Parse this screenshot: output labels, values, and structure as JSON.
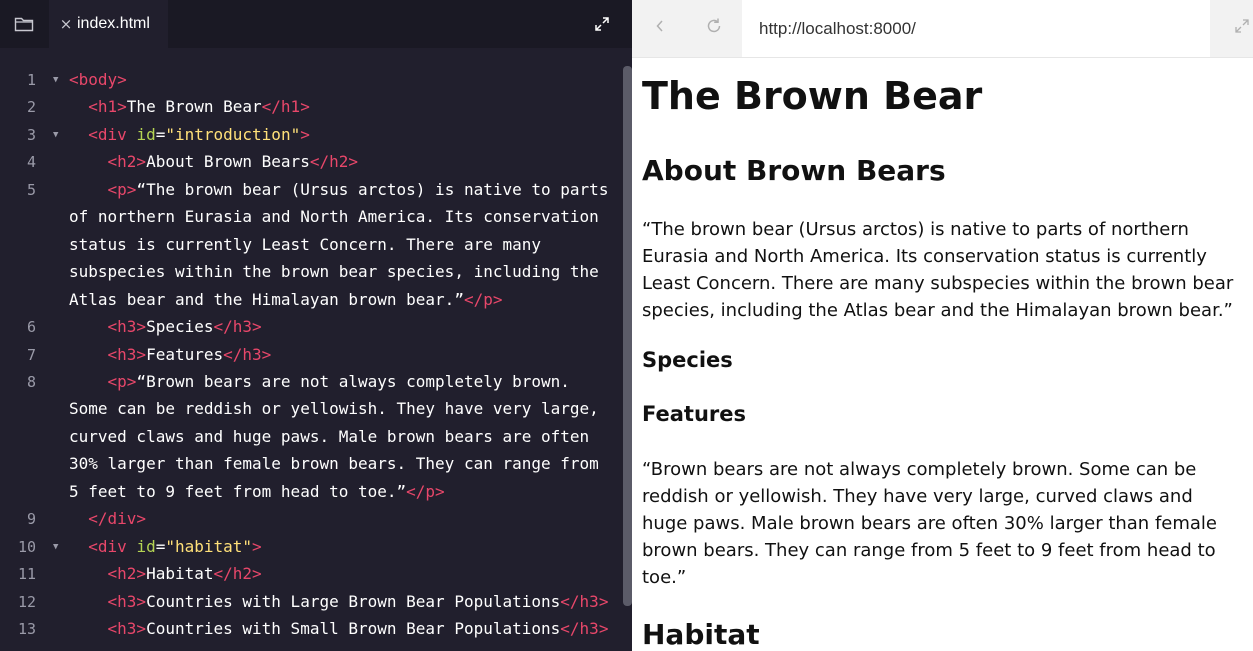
{
  "editor": {
    "tab_close": "×",
    "tab_label": "index.html",
    "icons": {
      "folder": "folder-icon",
      "expand": "expand-icon"
    },
    "lines": [
      {
        "num": "1",
        "fold": true,
        "parts": [
          {
            "t": "tag",
            "v": "<body>"
          }
        ]
      },
      {
        "num": "2",
        "fold": false,
        "parts": [
          {
            "t": "txt",
            "v": "  "
          },
          {
            "t": "tag",
            "v": "<h1>"
          },
          {
            "t": "txt",
            "v": "The Brown Bear"
          },
          {
            "t": "tag",
            "v": "</h1>"
          }
        ]
      },
      {
        "num": "3",
        "fold": true,
        "parts": [
          {
            "t": "txt",
            "v": "  "
          },
          {
            "t": "tag",
            "v": "<div "
          },
          {
            "t": "attr",
            "v": "id"
          },
          {
            "t": "txt",
            "v": "="
          },
          {
            "t": "str",
            "v": "\"introduction\""
          },
          {
            "t": "tag",
            "v": ">"
          }
        ]
      },
      {
        "num": "4",
        "fold": false,
        "parts": [
          {
            "t": "txt",
            "v": "    "
          },
          {
            "t": "tag",
            "v": "<h2>"
          },
          {
            "t": "txt",
            "v": "About Brown Bears"
          },
          {
            "t": "tag",
            "v": "</h2>"
          }
        ]
      },
      {
        "num": "5",
        "fold": false,
        "parts": [
          {
            "t": "txt",
            "v": "    "
          },
          {
            "t": "tag",
            "v": "<p>"
          },
          {
            "t": "txt",
            "v": "“The brown bear (Ursus arctos) is native to parts"
          }
        ],
        "wraps": [
          [
            {
              "t": "txt",
              "v": "of northern Eurasia and North America. Its conservation"
            }
          ],
          [
            {
              "t": "txt",
              "v": "status is currently Least Concern. There are many"
            }
          ],
          [
            {
              "t": "txt",
              "v": "subspecies within the brown bear species, including the"
            }
          ],
          [
            {
              "t": "txt",
              "v": "Atlas bear and the Himalayan brown bear.”"
            },
            {
              "t": "tag",
              "v": "</p>"
            }
          ]
        ]
      },
      {
        "num": "6",
        "fold": false,
        "parts": [
          {
            "t": "txt",
            "v": "    "
          },
          {
            "t": "tag",
            "v": "<h3>"
          },
          {
            "t": "txt",
            "v": "Species"
          },
          {
            "t": "tag",
            "v": "</h3>"
          }
        ]
      },
      {
        "num": "7",
        "fold": false,
        "parts": [
          {
            "t": "txt",
            "v": "    "
          },
          {
            "t": "tag",
            "v": "<h3>"
          },
          {
            "t": "txt",
            "v": "Features"
          },
          {
            "t": "tag",
            "v": "</h3>"
          }
        ]
      },
      {
        "num": "8",
        "fold": false,
        "parts": [
          {
            "t": "txt",
            "v": "    "
          },
          {
            "t": "tag",
            "v": "<p>"
          },
          {
            "t": "txt",
            "v": "“Brown bears are not always completely brown."
          }
        ],
        "wraps": [
          [
            {
              "t": "txt",
              "v": "Some can be reddish or yellowish. They have very large,"
            }
          ],
          [
            {
              "t": "txt",
              "v": "curved claws and huge paws. Male brown bears are often"
            }
          ],
          [
            {
              "t": "txt",
              "v": "30% larger than female brown bears. They can range from"
            }
          ],
          [
            {
              "t": "txt",
              "v": "5 feet to 9 feet from head to toe.”"
            },
            {
              "t": "tag",
              "v": "</p>"
            }
          ]
        ]
      },
      {
        "num": "9",
        "fold": false,
        "parts": [
          {
            "t": "txt",
            "v": "  "
          },
          {
            "t": "tag",
            "v": "</div>"
          }
        ]
      },
      {
        "num": "10",
        "fold": true,
        "parts": [
          {
            "t": "txt",
            "v": "  "
          },
          {
            "t": "tag",
            "v": "<div "
          },
          {
            "t": "attr",
            "v": "id"
          },
          {
            "t": "txt",
            "v": "="
          },
          {
            "t": "str",
            "v": "\"habitat\""
          },
          {
            "t": "tag",
            "v": ">"
          }
        ]
      },
      {
        "num": "11",
        "fold": false,
        "parts": [
          {
            "t": "txt",
            "v": "    "
          },
          {
            "t": "tag",
            "v": "<h2>"
          },
          {
            "t": "txt",
            "v": "Habitat"
          },
          {
            "t": "tag",
            "v": "</h2>"
          }
        ]
      },
      {
        "num": "12",
        "fold": false,
        "parts": [
          {
            "t": "txt",
            "v": "    "
          },
          {
            "t": "tag",
            "v": "<h3>"
          },
          {
            "t": "txt",
            "v": "Countries with Large Brown Bear Populations"
          },
          {
            "t": "tag",
            "v": "</h3>"
          }
        ]
      },
      {
        "num": "13",
        "fold": false,
        "parts": [
          {
            "t": "txt",
            "v": "    "
          },
          {
            "t": "tag",
            "v": "<h3>"
          },
          {
            "t": "txt",
            "v": "Countries with Small Brown Bear Populations"
          },
          {
            "t": "tag",
            "v": "</h3>"
          }
        ]
      }
    ]
  },
  "browser": {
    "url": "http://localhost:8000/",
    "icons": {
      "back": "chevron-left-icon",
      "refresh": "refresh-icon",
      "expand": "expand-icon"
    },
    "page": {
      "h1": "The Brown Bear",
      "h2_about": "About Brown Bears",
      "p_intro": "“The brown bear (Ursus arctos) is native to parts of northern Eurasia and North America. Its conservation status is currently Least Concern. There are many subspecies within the brown bear species, including the Atlas bear and the Himalayan brown bear.”",
      "h3_species": "Species",
      "h3_features": "Features",
      "p_features": "“Brown bears are not always completely brown. Some can be reddish or yellowish. They have very large, curved claws and huge paws. Male brown bears are often 30% larger than female brown bears. They can range from 5 feet to 9 feet from head to toe.”",
      "h2_habitat": "Habitat"
    }
  },
  "colors": {
    "editor_bg": "#211f2d",
    "tag": "#e8476a",
    "attr": "#b4d353",
    "string": "#ffe079"
  }
}
